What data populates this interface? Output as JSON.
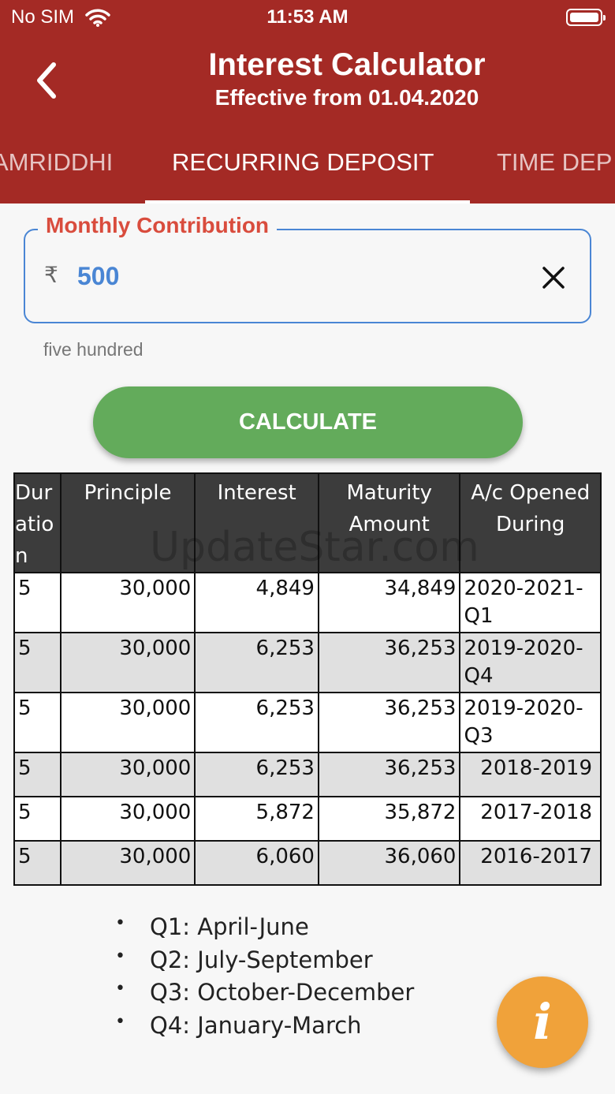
{
  "status_bar": {
    "carrier": "No SIM",
    "time": "11:53 AM"
  },
  "header": {
    "title": "Interest Calculator",
    "subtitle": "Effective from 01.04.2020"
  },
  "tabs": [
    {
      "label": "AMRIDDHI",
      "active": false
    },
    {
      "label": "RECURRING DEPOSIT",
      "active": true
    },
    {
      "label": "TIME DEP",
      "active": false
    }
  ],
  "input": {
    "label": "Monthly Contribution",
    "currency_symbol": "₹",
    "value": "500",
    "helper": "five hundred"
  },
  "calculate_label": "CALCULATE",
  "table": {
    "headers": [
      "Duration",
      "Principle",
      "Interest",
      "Maturity Amount",
      "A/c Opened During"
    ],
    "rows": [
      [
        "5",
        "30,000",
        "4,849",
        "34,849",
        "2020-2021-Q1"
      ],
      [
        "5",
        "30,000",
        "6,253",
        "36,253",
        "2019-2020-Q4"
      ],
      [
        "5",
        "30,000",
        "6,253",
        "36,253",
        "2019-2020-Q3"
      ],
      [
        "5",
        "30,000",
        "6,253",
        "36,253",
        "2018-2019"
      ],
      [
        "5",
        "30,000",
        "5,872",
        "35,872",
        "2017-2018"
      ],
      [
        "5",
        "30,000",
        "6,060",
        "36,060",
        "2016-2017"
      ]
    ]
  },
  "watermark": "UpdateStar.com",
  "quarters": [
    "Q1:  April-June",
    "Q2:  July-September",
    "Q3:  October-December",
    "Q4:  January-March"
  ],
  "info_label": "i",
  "colors": {
    "header_bg": "#a42a25",
    "accent_blue": "#4a86d4",
    "label_red": "#d94c3d",
    "button_green": "#63ab5b",
    "fab_orange": "#f0a23a",
    "table_header_bg": "#3c3c3c"
  }
}
